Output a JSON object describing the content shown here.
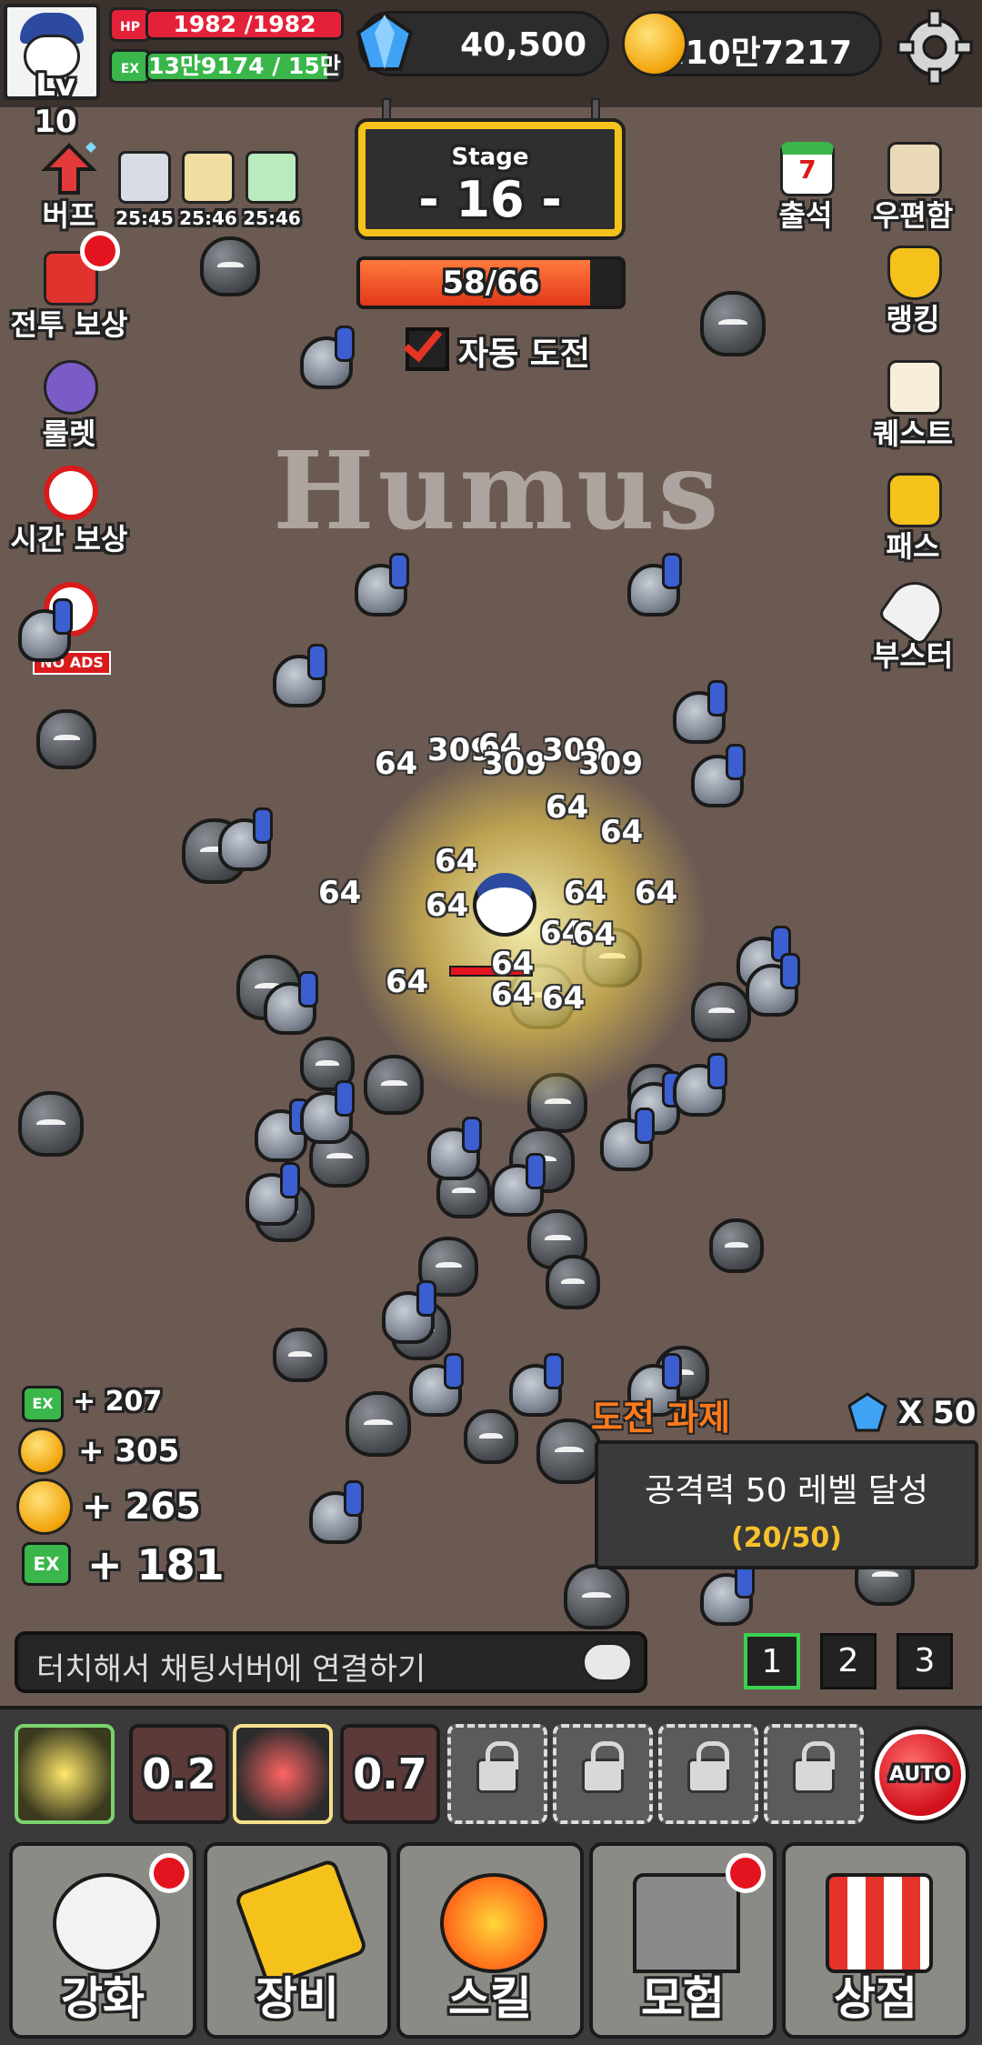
{
  "hud": {
    "level": "Lv 10",
    "hp_tag": "HP",
    "hp_text": "1982 /1982",
    "hp_fraction": 1.0,
    "ex_tag": "EX",
    "ex_text": "13만9174  / 15만",
    "ex_fraction": 0.93,
    "gems": "40,500",
    "gold": "210만7217"
  },
  "stage": {
    "label": "Stage",
    "value": "- 16 -",
    "progress_text": "58/66",
    "progress_fraction": 0.879,
    "auto_challenge_label": "자동 도전",
    "auto_challenge_checked": true
  },
  "left_menu": {
    "buff_label": "버프",
    "buff_timers": [
      "25:45",
      "25:46",
      "25:46"
    ],
    "battle_reward_label": "전투 보상",
    "roulette_label": "룰렛",
    "time_reward_label": "시간 보상",
    "no_ads_label": "NO ADS"
  },
  "right_menu": {
    "attendance_label": "출석",
    "attendance_day": "7",
    "mailbox_label": "우편함",
    "ranking_label": "랭킹",
    "quest_label": "퀘스트",
    "pass_label": "패스",
    "booster_label": "부스터"
  },
  "watermark": "Humus",
  "damage_numbers": [
    "309",
    "64",
    "309",
    "309",
    "64",
    "309",
    "64",
    "64",
    "64",
    "64",
    "64",
    "64",
    "64",
    "64",
    "64",
    "64",
    "64",
    "64",
    "64"
  ],
  "reward_log": [
    {
      "type": "ex",
      "tag": "EX",
      "text": "+ 207"
    },
    {
      "type": "gold",
      "text": "+ 305"
    },
    {
      "type": "gold",
      "text": "+ 265"
    },
    {
      "type": "ex",
      "tag": "EX",
      "text": "+ 181"
    }
  ],
  "challenge": {
    "title": "도전 과제",
    "reward": "X 50",
    "description": "공격력 50 레벨 달성",
    "progress": "(20/50)"
  },
  "chat": {
    "placeholder": "터치해서 채팅서버에 연결하기"
  },
  "pages": [
    "1",
    "2",
    "3"
  ],
  "active_page": "1",
  "skills": {
    "slot2_cooldown": "0.2",
    "slot4_cooldown": "0.7",
    "auto_label": "AUTO"
  },
  "nav": {
    "upgrade": "강화",
    "equipment": "장비",
    "skill": "스킬",
    "adventure": "모험",
    "shop": "상점"
  },
  "colors": {
    "hp_bar": "#e3223a",
    "ex_bar": "#3ab64a",
    "progress_bar": "#e1381a",
    "background": "#6b5a52",
    "challenge_title": "#ff7a1a",
    "active_page_border": "#3ad24f"
  }
}
